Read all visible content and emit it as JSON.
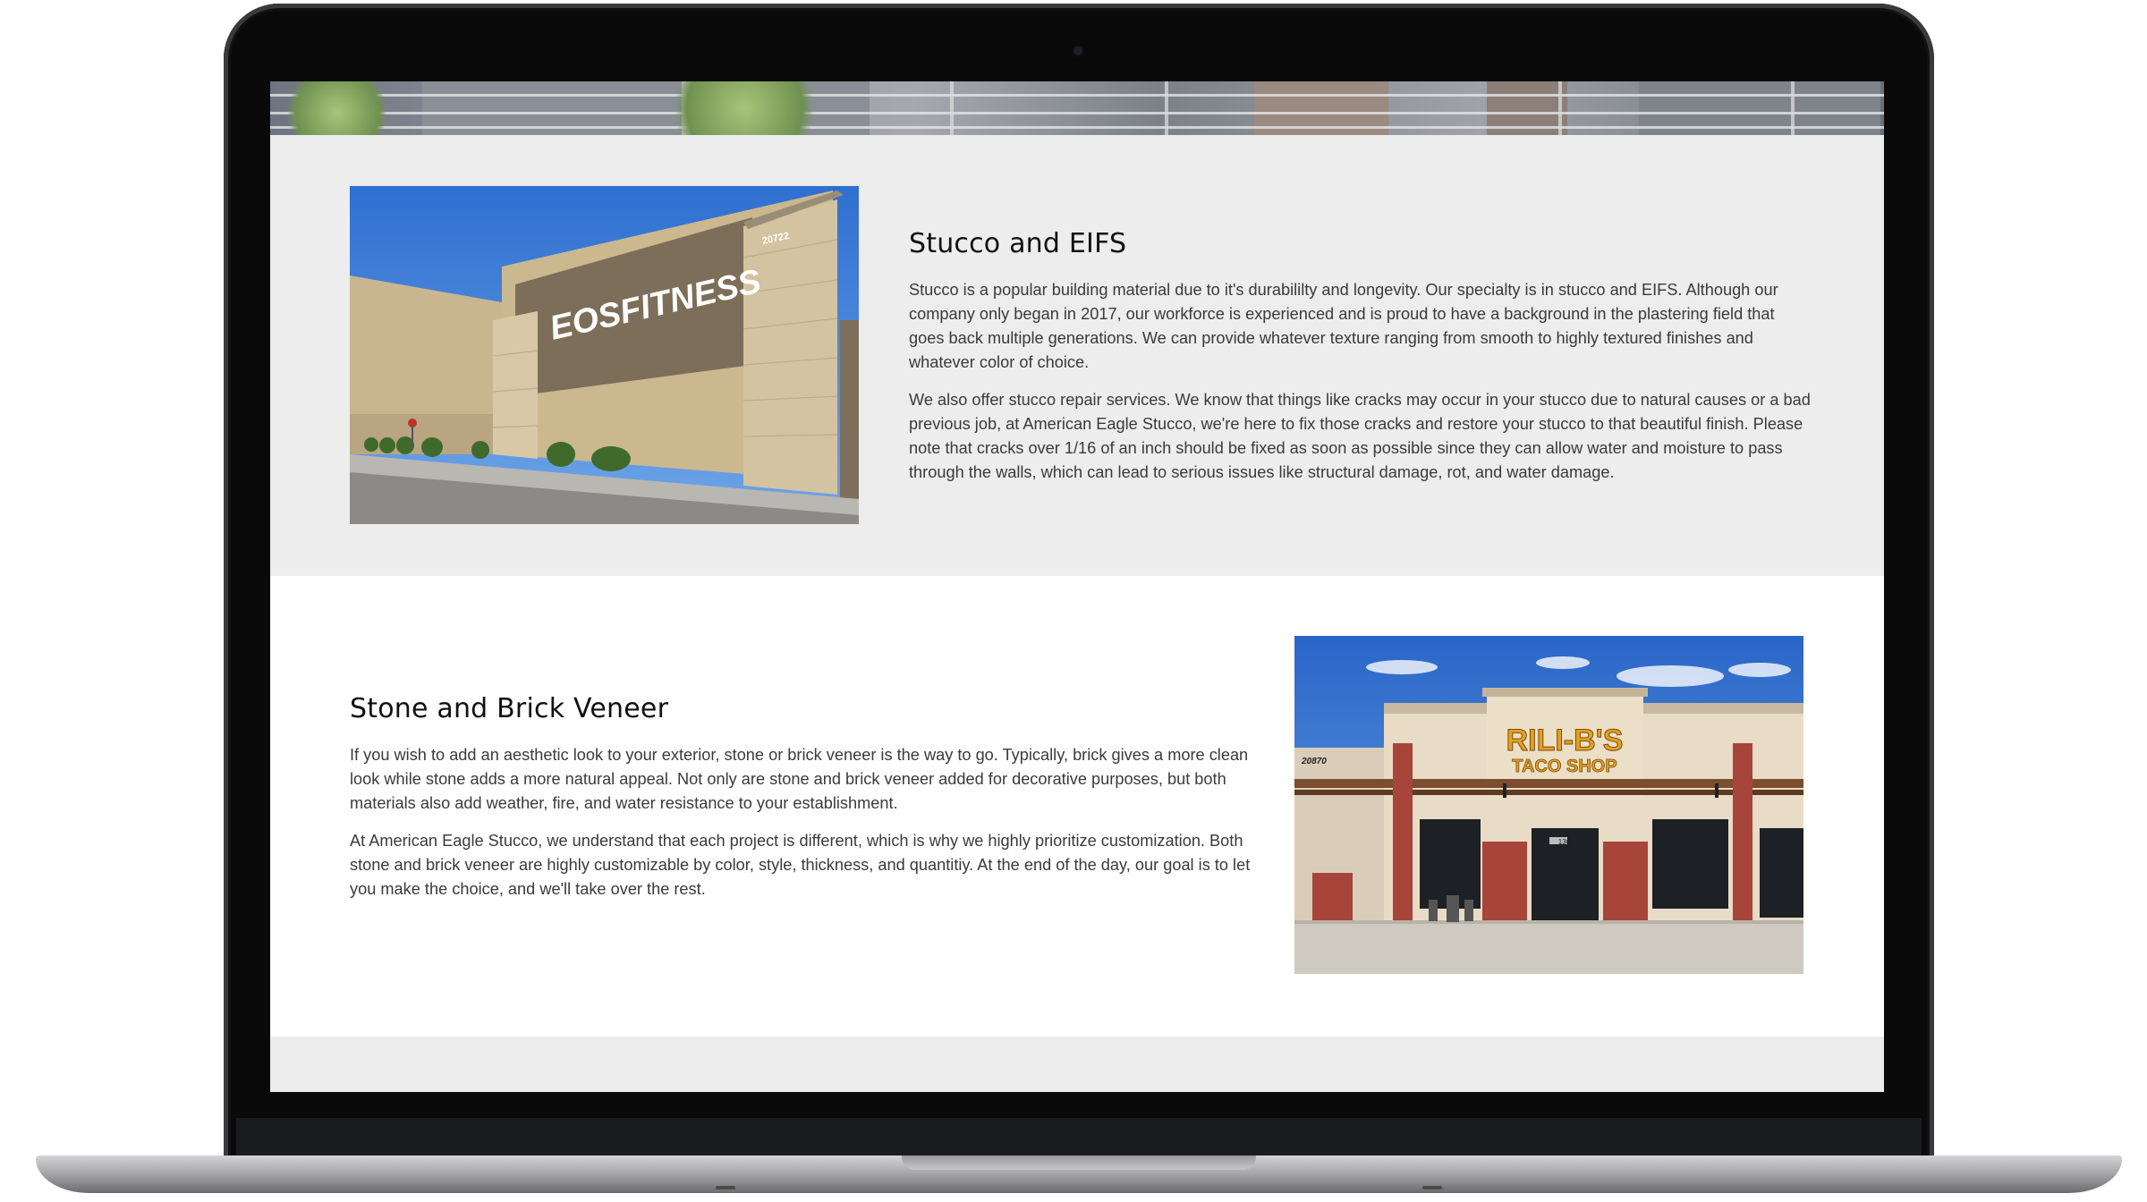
{
  "sections": [
    {
      "title": "Stucco and EIFS",
      "paragraphs": [
        "Stucco is a popular building material due to it's durabililty and longevity. Our specialty is in stucco and EIFS. Although our company only began in 2017, our workforce is experienced and is proud to have a background in the plastering field that goes back multiple generations. We can provide whatever texture ranging from smooth to highly textured finishes and whatever color of choice.",
        "We also offer stucco repair services. We know that things like cracks may occur in your stucco due to natural causes or a bad previous job, at American Eagle Stucco, we're here to fix those cracks and restore your stucco to that beautiful finish. Please note that cracks over 1/16 of an inch should be fixed as soon as possible since they can allow water and moisture to pass through the walls, which can lead to serious issues like structural damage, rot, and water damage."
      ],
      "photo": {
        "sign_text": "EOSFITNESS",
        "address": "20722"
      }
    },
    {
      "title": "Stone and Brick Veneer",
      "paragraphs": [
        "If you wish to add an aesthetic look to your exterior, stone or brick veneer is the way to go. Typically, brick gives a more clean look while stone adds a more natural appeal. Not only are stone and brick veneer added for decorative purposes, but both materials also add weather, fire, and water resistance to your establishment.",
        "At American Eagle Stucco, we understand that each project is different, which is why we highly prioritize customization. Both stone and brick veneer are highly customizable by color, style, thickness, and quantitiy. At the end of the day, our goal is to let you make the choice, and we'll take over the rest."
      ],
      "photo": {
        "sign_line1": "RILI-B'S",
        "sign_line2": "TACO SHOP",
        "address": "20870",
        "suite": "130-1"
      }
    }
  ],
  "colors": {
    "section_gray": "#ededed",
    "section_white": "#ffffff",
    "heading": "#111111",
    "body_text": "#3a3a3a",
    "laptop_frame": "#0a0a0a"
  }
}
